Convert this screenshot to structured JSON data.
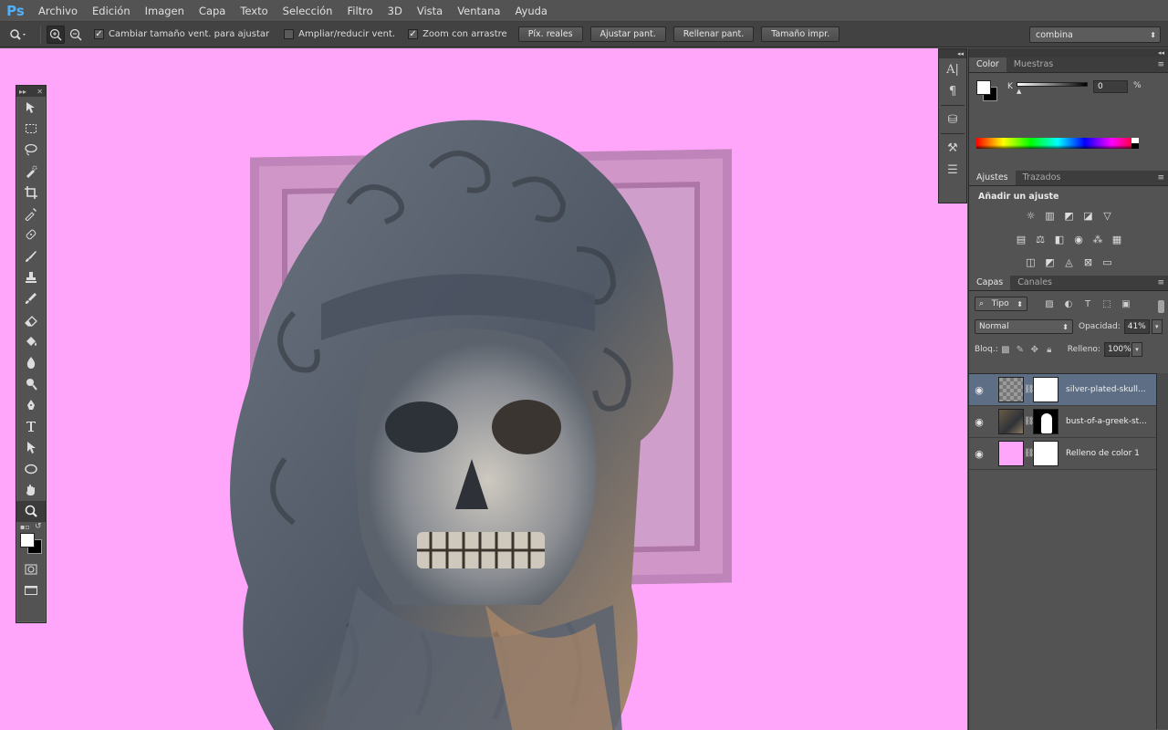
{
  "app": {
    "logo": "Ps"
  },
  "menu": [
    "Archivo",
    "Edición",
    "Imagen",
    "Capa",
    "Texto",
    "Selección",
    "Filtro",
    "3D",
    "Vista",
    "Ventana",
    "Ayuda"
  ],
  "options": {
    "resize_windows": {
      "label": "Cambiar tamaño vent. para ajustar",
      "checked": true
    },
    "zoom_all": {
      "label": "Ampliar/reducir vent.",
      "checked": false
    },
    "scrubby": {
      "label": "Zoom con arrastre",
      "checked": true
    },
    "buttons": [
      "Píx. reales",
      "Ajustar pant.",
      "Rellenar pant.",
      "Tamaño impr."
    ],
    "workspace": "combina"
  },
  "canvas": {
    "background": "#ffa6fb"
  },
  "panels": {
    "color": {
      "tabs": [
        "Color",
        "Muestras"
      ],
      "k_label": "K",
      "k_value": "0",
      "percent": "%"
    },
    "adjustments": {
      "tabs": [
        "Ajustes",
        "Trazados"
      ],
      "title": "Añadir un ajuste"
    },
    "layers": {
      "tabs": [
        "Capas",
        "Canales"
      ],
      "filter_kind": "Tipo",
      "blend_mode": "Normal",
      "opacity_label": "Opacidad:",
      "opacity": "41%",
      "lock_label": "Bloq.:",
      "fill_label": "Relleno:",
      "fill": "100%",
      "items": [
        {
          "name": "silver-plated-skull...",
          "selected": true
        },
        {
          "name": "bust-of-a-greek-st...",
          "selected": false
        },
        {
          "name": "Relleno de color 1",
          "selected": false
        }
      ]
    }
  }
}
